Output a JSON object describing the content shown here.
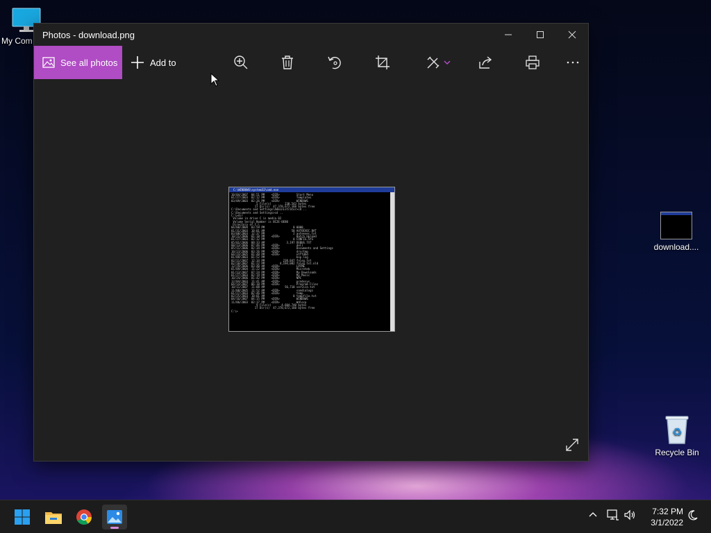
{
  "desktop": {
    "icons": [
      {
        "label": "My Com"
      },
      {
        "label": "download...."
      },
      {
        "label": "Recycle Bin"
      }
    ]
  },
  "window": {
    "title": "Photos - download.png",
    "toolbar": {
      "see_all_label": "See all photos",
      "add_to_label": "Add to"
    }
  },
  "photo": {
    "title": "C:\\WINDOWS\\system32\\cmd.exe",
    "lines": [
      "10/04/2007  04:51 PM    <DIR>          Start Menu",
      "01/27/2003  02:12 PM    <DIR>          Templates",
      "03/09/2003  02:26 PM    <DIR>          WINDOWS",
      "               5 File(s)        230,543 bytes",
      "              17 Dir(s)  47,370,672,160 bytes free",
      "",
      "C:\\Documents and Settings\\Administrator>cd ..",
      "",
      "C:\\Documents and Settings>cd ..",
      "",
      "C:\\>dir",
      " Volume in drive C is media 02",
      " Volume Serial Number is BC2E-0E80",
      "",
      " Directory of C:\\",
      "",
      "04/08/2004  03:59 PM                 0 0000_",
      "01/31/2003  10:01 AM                58 AUTOEXEC.BAT",
      "03/08/2003  12:37 PM                 2 autoexec.txt",
      "10/21/2006  01:18 PM    <DIR>          Batch_Upload",
      "01/27/2003  02:12 PM                 0 CONFIG.SYS",
      "05/01/2006  09:33 AM             3,197 DEBUG.TXT",
      "08/13/2006  07:46 PM    <DIR>          dell",
      "05/11/2006  02:34 PM    <DIR>          Documents and Settings",
      "10/13/2006  03:26 PM    <DIR>          drvrtmp",
      "04/24/2005  01:48 PM    <DIR>          ntffdbd",
      "01/09/2003  01:52 PM                   bsp.log",
      "02/11/2007  12:14 PM           238,847 fnlog.txt",
      "02/10/2007  01:22 PM         4,194,082 fnlog.txt.old",
      "12/29/2006  03:40 AM    <DIR>          LPCME",
      "01/09/2004  11:22 AM    <DIR>          Microtek",
      "01/13/2007  07:24 PM    <DIR>          My Downloads",
      "01/27/2003  02:19 PM    <DIR>          My Music",
      "10/24/2006  01:42 PM    <DIR>          NPC",
      "12/04/2003  11:41 AM    <DIR>          pcndxsys",
      "04/14/2007  06:10 PM    <DIR>          Program Files",
      "10/11/2007  11:08 AM            56,710 service.txt",
      "11/08/2005  11:52 AM    <DIR>          sandialogs",
      "01/27/2003  02:46 PM    <DIR>          temp",
      "02/25/2003  10:01 AM                 0 tempfile.txt",
      "04/16/2007  04:15 PM    <DIR>          WINDOWS",
      "11/06/2003  02:17 PM    <DIR>          Wdlocp",
      "               9 File(s)      4,604,740 bytes",
      "              17 Dir(s)  47,370,672,160 bytes free",
      "",
      "C:\\>"
    ]
  },
  "taskbar": {
    "clock_time": "7:32 PM",
    "clock_date": "3/1/2022"
  },
  "colors": {
    "accent": "#b04cc4",
    "window_bg": "#202020",
    "taskbar_bg": "#1c1c1c"
  }
}
